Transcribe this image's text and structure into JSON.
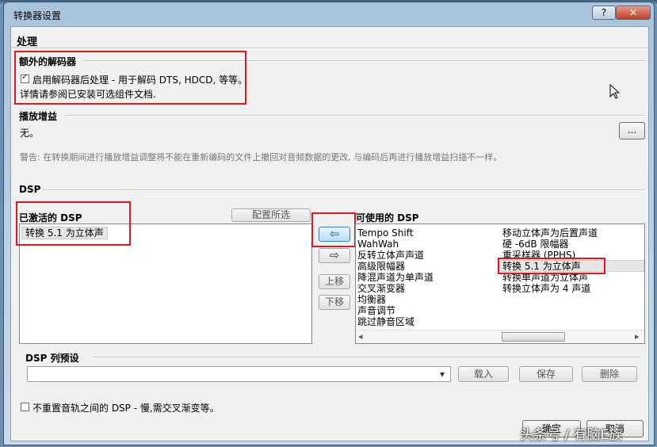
{
  "window": {
    "title": "转换器设置",
    "help": "?",
    "close": "✕"
  },
  "page_title": "处理",
  "decoder": {
    "heading": "额外的解码器",
    "checkbox_label": "启用解码器后处理 - 用于解码 DTS, HDCD, 等等。",
    "checked": true,
    "info": "详情请参阅已安装可选组件文档."
  },
  "replaygain": {
    "heading": "播放增益",
    "value": "无。",
    "browse_label": "...",
    "warning": "警告: 在转换期间进行播放增益调整将不能在重新编码的文件上撤回对音频数据的更改, 与编码后再进行播放增益扫描不一样。"
  },
  "dsp": {
    "heading": "DSP",
    "active_heading": "已激活的 DSP",
    "configure_label": "配置所选",
    "active_items": [
      "转换 5.1 为立体声"
    ],
    "available_heading": "可使用的 DSP",
    "available_col1": [
      "Tempo Shift",
      "WahWah",
      "反转立体声声道",
      "高级限幅器",
      "降混声道为单声道",
      "交叉渐变器",
      "均衡器",
      "声音调节",
      "跳过静音区域"
    ],
    "available_col2": [
      "移动立体声为后置声道",
      "硬 -6dB 限幅器",
      "重采样器 (PPHS)",
      "转换 5.1 为立体声",
      "转换单声道为立体声",
      "转换立体声为 4 声道"
    ],
    "add_arrow": "⇦",
    "remove_arrow": "⇨",
    "up_label": "上移",
    "down_label": "下移",
    "scroll_left": "◂",
    "scroll_right": "▸"
  },
  "preset": {
    "heading": "DSP 列预设",
    "value": "",
    "dropdown_arrow": "▾",
    "load_label": "载入",
    "save_label": "保存",
    "delete_label": "删除"
  },
  "reset": {
    "label": "不重置音轨之间的 DSP - 慢,需交叉渐变等。",
    "checked": false
  },
  "footer": {
    "ok_label": "确定",
    "cancel_label": "取消"
  },
  "watermark": "头条号 / 有脑E族"
}
